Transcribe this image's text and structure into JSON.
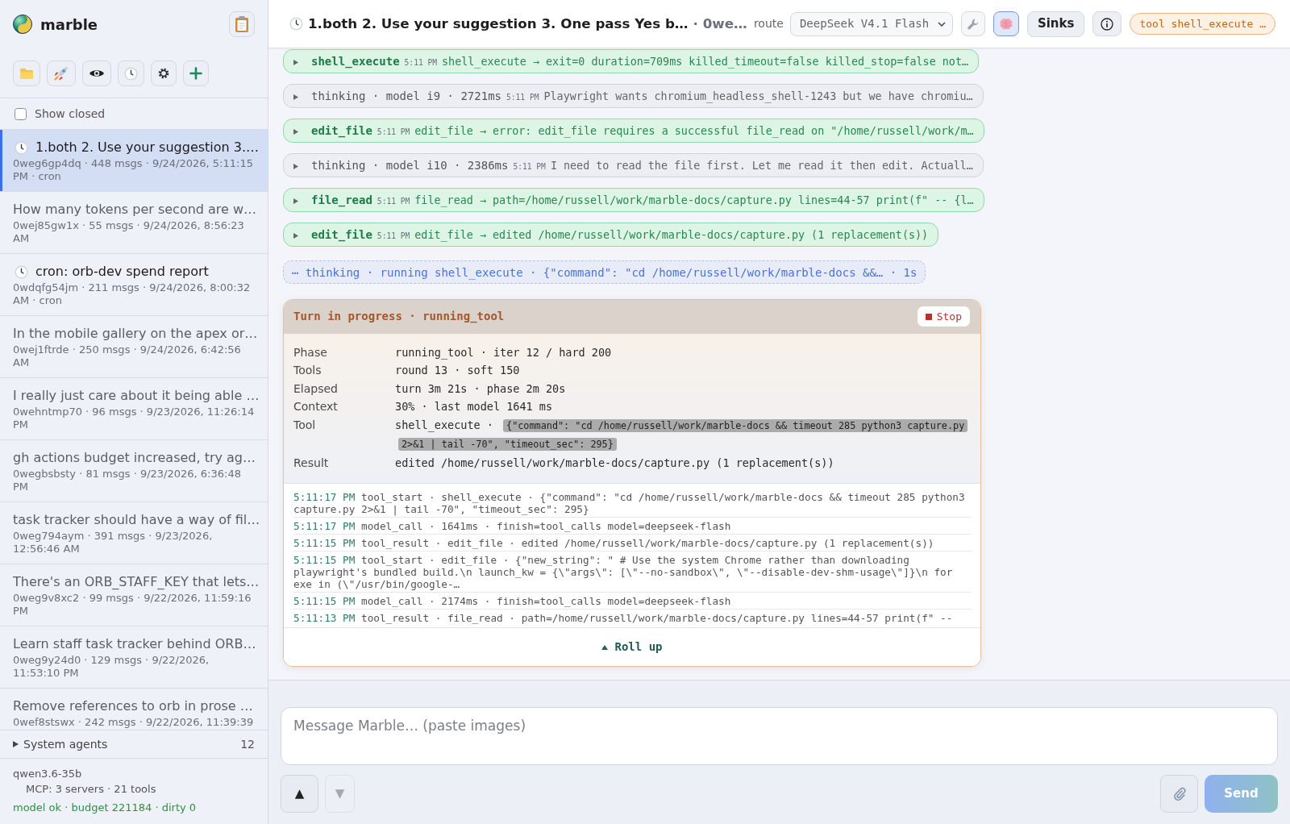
{
  "sidebar": {
    "brand": "marble",
    "show_closed": {
      "label": "Show closed",
      "checked": false
    },
    "sessions": [
      {
        "title": "1.both 2. Use your suggestion 3.…",
        "meta": "0weg6gp4dq · 448 msgs · 9/24/2026, 5:11:15 PM · cron",
        "scheduled": true,
        "selected": true
      },
      {
        "title": "How many tokens per second are w…",
        "meta": "0wej85gw1x · 55 msgs · 9/24/2026, 8:56:23 AM",
        "scheduled": false,
        "selected": false
      },
      {
        "title": "cron: orb-dev spend report",
        "meta": "0wdqfg54jm · 211 msgs · 9/24/2026, 8:00:32 AM · cron",
        "scheduled": true,
        "selected": false
      },
      {
        "title": "In the mobile gallery on the apex or…",
        "meta": "0wej1ftrde · 250 msgs · 9/24/2026, 6:42:56 AM",
        "scheduled": false,
        "selected": false
      },
      {
        "title": "I really just care about it being able …",
        "meta": "0wehntmp70 · 96 msgs · 9/23/2026, 11:26:14 PM",
        "scheduled": false,
        "selected": false
      },
      {
        "title": "gh actions budget increased, try ag…",
        "meta": "0wegbsbsty · 81 msgs · 9/23/2026, 6:36:48 PM",
        "scheduled": false,
        "selected": false
      },
      {
        "title": "task tracker should have a way of fil…",
        "meta": "0weg794aym · 391 msgs · 9/23/2026, 12:56:46 AM",
        "scheduled": false,
        "selected": false
      },
      {
        "title": "There's an ORB_STAFF_KEY that lets…",
        "meta": "0weg9v8xc2 · 99 msgs · 9/22/2026, 11:59:16 PM",
        "scheduled": false,
        "selected": false
      },
      {
        "title": "Learn staff task tracker behind ORB…",
        "meta": "0weg9y24d0 · 129 msgs · 9/22/2026, 11:53:10 PM",
        "scheduled": false,
        "selected": false
      },
      {
        "title": "Remove references to orb in prose …",
        "meta": "0wef8stswx · 242 msgs · 9/22/2026, 11:39:39",
        "scheduled": false,
        "selected": false
      }
    ],
    "system_agents": {
      "label": "System agents",
      "count": "12",
      "expanded": false
    },
    "footer": {
      "model": "qwen3.6-35b",
      "mcp": "MCP: 3 servers · 21 tools",
      "status": "model ok · budget 221184 · dirty 0"
    }
  },
  "header": {
    "scheduled": true,
    "title": "1.both 2. Use your suggestion 3. One pass Yes b…",
    "session_id": "· 0we…",
    "route_label": "route",
    "route": "DeepSeek V4.1 Flash",
    "toggles": [
      {
        "on": false
      },
      {
        "on": true
      }
    ],
    "sinks_label": "Sinks",
    "tool_status": "tool shell_execute …"
  },
  "events": [
    {
      "kind": "tool",
      "expanded": false,
      "name": "shell_execute",
      "time": "5:11 PM",
      "summary": "shell_execute → exit=0 duration=709ms killed_timeout=false killed_stop=false not…"
    },
    {
      "kind": "thinking",
      "expanded": false,
      "name": "thinking · model i9 · 2721ms",
      "time": "5:11 PM",
      "summary": "Playwright wants chromium_headless_shell-1243 but we have chromiu…"
    },
    {
      "kind": "tool",
      "expanded": false,
      "name": "edit_file",
      "time": "5:11 PM",
      "summary": "edit_file → error: edit_file requires a successful file_read on \"/home/russell/work/m…"
    },
    {
      "kind": "thinking",
      "expanded": false,
      "name": "thinking · model i10 · 2386ms",
      "time": "5:11 PM",
      "summary": "I need to read the file first. Let me read it then edit. Actuall…"
    },
    {
      "kind": "tool",
      "expanded": false,
      "name": "file_read",
      "time": "5:11 PM",
      "summary": "file_read → path=/home/russell/work/marble-docs/capture.py lines=44-57 print(f\" -- {l…"
    },
    {
      "kind": "tool",
      "expanded": false,
      "name": "edit_file",
      "time": "5:11 PM",
      "summary": "edit_file → edited /home/russell/work/marble-docs/capture.py (1 replacement(s))"
    },
    {
      "kind": "pending",
      "text": "⋯ thinking · running shell_execute · {\"command\": \"cd /home/russell/work/marble-docs &&… · 1s"
    }
  ],
  "turn": {
    "title": "Turn in progress · running_tool",
    "stop": "Stop",
    "details": [
      {
        "label": "Phase",
        "value": "running_tool · iter 12 / hard 200"
      },
      {
        "label": "Tools",
        "value": "round 13 · soft 150"
      },
      {
        "label": "Elapsed",
        "value": "turn 3m 21s · phase 2m 20s"
      },
      {
        "label": "Context",
        "value": "30% · last model 1641 ms"
      },
      {
        "label": "Tool",
        "value": "shell_execute ·",
        "code": "{\"command\": \"cd /home/russell/work/marble-docs && timeout 285 python3 capture.py 2>&1 | tail -70\", \"timeout_sec\": 295}"
      },
      {
        "label": "Result",
        "value": "edited /home/russell/work/marble-docs/capture.py (1 replacement(s))"
      }
    ],
    "log": [
      {
        "time": "5:11:17 PM",
        "text": "tool_start · shell_execute · {\"command\": \"cd /home/russell/work/marble-docs && timeout 285 python3 capture.py 2>&1 | tail -70\", \"timeout_sec\": 295}"
      },
      {
        "time": "5:11:17 PM",
        "text": "model_call · 1641ms · finish=tool_calls model=deepseek-flash"
      },
      {
        "time": "5:11:15 PM",
        "text": "tool_result · edit_file · edited /home/russell/work/marble-docs/capture.py (1 replacement(s))"
      },
      {
        "time": "5:11:15 PM",
        "text": "tool_start · edit_file · {\"new_string\": \" # Use the system Chrome rather than downloading playwright's bundled build.\\n launch_kw = {\\\"args\\\": [\\\"--no-sandbox\\\", \\\"--disable-dev-shm-usage\\\"]}\\n for exe in (\\\"/usr/bin/google-…"
      },
      {
        "time": "5:11:15 PM",
        "text": "model_call · 2174ms · finish=tool_calls model=deepseek-flash"
      },
      {
        "time": "5:11:13 PM",
        "text": "tool_result · file_read · path=/home/russell/work/marble-docs/capture.py lines=44-57 print(f\" --"
      }
    ],
    "rollup": "Roll up"
  },
  "composer": {
    "placeholder": "Message Marble… (paste images)",
    "history": [
      {
        "label": "▲",
        "disabled": false
      },
      {
        "label": "▼",
        "disabled": true
      }
    ],
    "send": {
      "label": "Send",
      "disabled": true
    }
  }
}
